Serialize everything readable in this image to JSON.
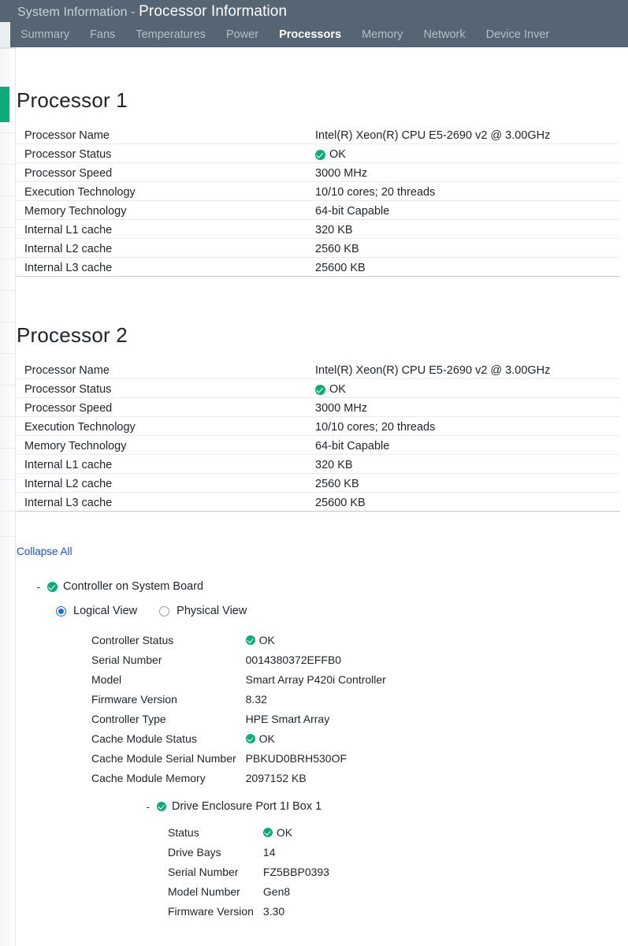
{
  "header": {
    "title_prefix": "System Information - ",
    "title_main": "Processor Information",
    "background_color": "#566573"
  },
  "tabs": [
    {
      "label": "Summary",
      "active": false
    },
    {
      "label": "Fans",
      "active": false
    },
    {
      "label": "Temperatures",
      "active": false
    },
    {
      "label": "Power",
      "active": false
    },
    {
      "label": "Processors",
      "active": true
    },
    {
      "label": "Memory",
      "active": false
    },
    {
      "label": "Network",
      "active": false
    },
    {
      "label": "Device Inver",
      "active": false
    }
  ],
  "sidebar": {
    "active_accent_color": "#0cab7a"
  },
  "processors": [
    {
      "title": "Processor 1",
      "rows": [
        {
          "label": "Processor Name",
          "value": "Intel(R) Xeon(R) CPU E5-2690 v2 @ 3.00GHz",
          "status": false
        },
        {
          "label": "Processor Status",
          "value": "OK",
          "status": true
        },
        {
          "label": "Processor Speed",
          "value": "3000 MHz",
          "status": false
        },
        {
          "label": "Execution Technology",
          "value": "10/10 cores; 20 threads",
          "status": false
        },
        {
          "label": "Memory Technology",
          "value": "64-bit Capable",
          "status": false
        },
        {
          "label": "Internal L1 cache",
          "value": "320 KB",
          "status": false
        },
        {
          "label": "Internal L2 cache",
          "value": "2560 KB",
          "status": false
        },
        {
          "label": "Internal L3 cache",
          "value": "25600 KB",
          "status": false
        }
      ]
    },
    {
      "title": "Processor 2",
      "rows": [
        {
          "label": "Processor Name",
          "value": "Intel(R) Xeon(R) CPU E5-2690 v2 @ 3.00GHz",
          "status": false
        },
        {
          "label": "Processor Status",
          "value": "OK",
          "status": true
        },
        {
          "label": "Processor Speed",
          "value": "3000 MHz",
          "status": false
        },
        {
          "label": "Execution Technology",
          "value": "10/10 cores; 20 threads",
          "status": false
        },
        {
          "label": "Memory Technology",
          "value": "64-bit Capable",
          "status": false
        },
        {
          "label": "Internal L1 cache",
          "value": "320 KB",
          "status": false
        },
        {
          "label": "Internal L2 cache",
          "value": "2560 KB",
          "status": false
        },
        {
          "label": "Internal L3 cache",
          "value": "25600 KB",
          "status": false
        }
      ]
    }
  ],
  "storage": {
    "collapse_all_label": "Collapse All",
    "controller": {
      "toggle": "-",
      "name": "Controller on System Board",
      "views": [
        {
          "label": "Logical View",
          "selected": true
        },
        {
          "label": "Physical View",
          "selected": false
        }
      ],
      "details": [
        {
          "label": "Controller Status",
          "value": "OK",
          "status": true
        },
        {
          "label": "Serial Number",
          "value": "0014380372EFFB0",
          "status": false
        },
        {
          "label": "Model",
          "value": "Smart Array P420i Controller",
          "status": false
        },
        {
          "label": "Firmware Version",
          "value": "8.32",
          "status": false
        },
        {
          "label": "Controller Type",
          "value": "HPE Smart Array",
          "status": false
        },
        {
          "label": "Cache Module Status",
          "value": "OK",
          "status": true
        },
        {
          "label": "Cache Module Serial Number",
          "value": "PBKUD0BRH530OF",
          "status": false
        },
        {
          "label": "Cache Module Memory",
          "value": "2097152 KB",
          "status": false
        }
      ],
      "enclosure": {
        "toggle": "-",
        "name": "Drive Enclosure Port 1I Box 1",
        "details": [
          {
            "label": "Status",
            "value": "OK",
            "status": true
          },
          {
            "label": "Drive Bays",
            "value": "14",
            "status": false
          },
          {
            "label": "Serial Number",
            "value": "FZ5BBP0393",
            "status": false
          },
          {
            "label": "Model Number",
            "value": "Gen8",
            "status": false
          },
          {
            "label": "Firmware Version",
            "value": "3.30",
            "status": false
          }
        ]
      }
    }
  }
}
